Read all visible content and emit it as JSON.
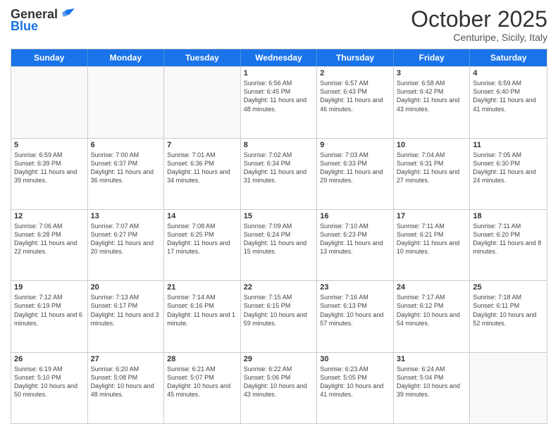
{
  "header": {
    "logo_general": "General",
    "logo_blue": "Blue",
    "month_title": "October 2025",
    "location": "Centuripe, Sicily, Italy"
  },
  "weekdays": [
    "Sunday",
    "Monday",
    "Tuesday",
    "Wednesday",
    "Thursday",
    "Friday",
    "Saturday"
  ],
  "rows": [
    [
      {
        "day": "",
        "info": ""
      },
      {
        "day": "",
        "info": ""
      },
      {
        "day": "",
        "info": ""
      },
      {
        "day": "1",
        "info": "Sunrise: 6:56 AM\nSunset: 6:45 PM\nDaylight: 11 hours and 48 minutes."
      },
      {
        "day": "2",
        "info": "Sunrise: 6:57 AM\nSunset: 6:43 PM\nDaylight: 11 hours and 46 minutes."
      },
      {
        "day": "3",
        "info": "Sunrise: 6:58 AM\nSunset: 6:42 PM\nDaylight: 11 hours and 43 minutes."
      },
      {
        "day": "4",
        "info": "Sunrise: 6:59 AM\nSunset: 6:40 PM\nDaylight: 11 hours and 41 minutes."
      }
    ],
    [
      {
        "day": "5",
        "info": "Sunrise: 6:59 AM\nSunset: 6:39 PM\nDaylight: 11 hours and 39 minutes."
      },
      {
        "day": "6",
        "info": "Sunrise: 7:00 AM\nSunset: 6:37 PM\nDaylight: 11 hours and 36 minutes."
      },
      {
        "day": "7",
        "info": "Sunrise: 7:01 AM\nSunset: 6:36 PM\nDaylight: 11 hours and 34 minutes."
      },
      {
        "day": "8",
        "info": "Sunrise: 7:02 AM\nSunset: 6:34 PM\nDaylight: 11 hours and 31 minutes."
      },
      {
        "day": "9",
        "info": "Sunrise: 7:03 AM\nSunset: 6:33 PM\nDaylight: 11 hours and 29 minutes."
      },
      {
        "day": "10",
        "info": "Sunrise: 7:04 AM\nSunset: 6:31 PM\nDaylight: 11 hours and 27 minutes."
      },
      {
        "day": "11",
        "info": "Sunrise: 7:05 AM\nSunset: 6:30 PM\nDaylight: 11 hours and 24 minutes."
      }
    ],
    [
      {
        "day": "12",
        "info": "Sunrise: 7:06 AM\nSunset: 6:28 PM\nDaylight: 11 hours and 22 minutes."
      },
      {
        "day": "13",
        "info": "Sunrise: 7:07 AM\nSunset: 6:27 PM\nDaylight: 11 hours and 20 minutes."
      },
      {
        "day": "14",
        "info": "Sunrise: 7:08 AM\nSunset: 6:25 PM\nDaylight: 11 hours and 17 minutes."
      },
      {
        "day": "15",
        "info": "Sunrise: 7:09 AM\nSunset: 6:24 PM\nDaylight: 11 hours and 15 minutes."
      },
      {
        "day": "16",
        "info": "Sunrise: 7:10 AM\nSunset: 6:23 PM\nDaylight: 11 hours and 13 minutes."
      },
      {
        "day": "17",
        "info": "Sunrise: 7:11 AM\nSunset: 6:21 PM\nDaylight: 11 hours and 10 minutes."
      },
      {
        "day": "18",
        "info": "Sunrise: 7:11 AM\nSunset: 6:20 PM\nDaylight: 11 hours and 8 minutes."
      }
    ],
    [
      {
        "day": "19",
        "info": "Sunrise: 7:12 AM\nSunset: 6:19 PM\nDaylight: 11 hours and 6 minutes."
      },
      {
        "day": "20",
        "info": "Sunrise: 7:13 AM\nSunset: 6:17 PM\nDaylight: 11 hours and 3 minutes."
      },
      {
        "day": "21",
        "info": "Sunrise: 7:14 AM\nSunset: 6:16 PM\nDaylight: 11 hours and 1 minute."
      },
      {
        "day": "22",
        "info": "Sunrise: 7:15 AM\nSunset: 6:15 PM\nDaylight: 10 hours and 59 minutes."
      },
      {
        "day": "23",
        "info": "Sunrise: 7:16 AM\nSunset: 6:13 PM\nDaylight: 10 hours and 57 minutes."
      },
      {
        "day": "24",
        "info": "Sunrise: 7:17 AM\nSunset: 6:12 PM\nDaylight: 10 hours and 54 minutes."
      },
      {
        "day": "25",
        "info": "Sunrise: 7:18 AM\nSunset: 6:11 PM\nDaylight: 10 hours and 52 minutes."
      }
    ],
    [
      {
        "day": "26",
        "info": "Sunrise: 6:19 AM\nSunset: 5:10 PM\nDaylight: 10 hours and 50 minutes."
      },
      {
        "day": "27",
        "info": "Sunrise: 6:20 AM\nSunset: 5:08 PM\nDaylight: 10 hours and 48 minutes."
      },
      {
        "day": "28",
        "info": "Sunrise: 6:21 AM\nSunset: 5:07 PM\nDaylight: 10 hours and 45 minutes."
      },
      {
        "day": "29",
        "info": "Sunrise: 6:22 AM\nSunset: 5:06 PM\nDaylight: 10 hours and 43 minutes."
      },
      {
        "day": "30",
        "info": "Sunrise: 6:23 AM\nSunset: 5:05 PM\nDaylight: 10 hours and 41 minutes."
      },
      {
        "day": "31",
        "info": "Sunrise: 6:24 AM\nSunset: 5:04 PM\nDaylight: 10 hours and 39 minutes."
      },
      {
        "day": "",
        "info": ""
      }
    ]
  ]
}
